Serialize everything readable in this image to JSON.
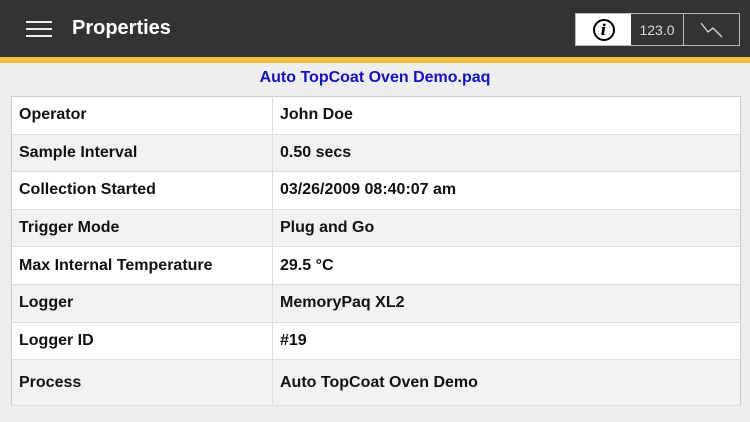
{
  "header": {
    "title": "Properties",
    "value_button": "123.0"
  },
  "file_name": "Auto TopCoat Oven Demo.paq",
  "properties": [
    {
      "label": "Operator",
      "value": "John Doe"
    },
    {
      "label": "Sample Interval",
      "value": "0.50 secs"
    },
    {
      "label": "Collection Started",
      "value": "03/26/2009 08:40:07 am"
    },
    {
      "label": "Trigger Mode",
      "value": "Plug and Go"
    },
    {
      "label": "Max Internal Temperature",
      "value": "29.5 °C"
    },
    {
      "label": "Logger",
      "value": "MemoryPaq XL2"
    },
    {
      "label": "Logger ID",
      "value": "#19"
    },
    {
      "label": "Process",
      "value": "Auto TopCoat Oven Demo"
    }
  ]
}
